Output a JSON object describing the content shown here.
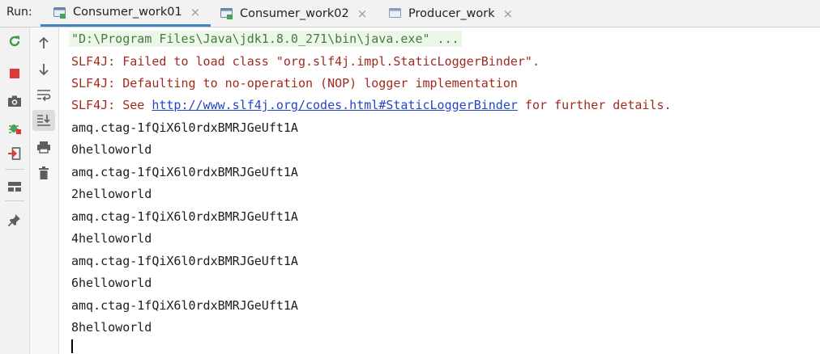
{
  "run_label": "Run:",
  "tabs": [
    {
      "label": "Consumer_work01",
      "active": true
    },
    {
      "label": "Consumer_work02",
      "active": false
    },
    {
      "label": "Producer_work",
      "active": false
    }
  ],
  "tab_close_glyph": "×",
  "toolbar_left": [
    {
      "icon": "rerun-icon"
    },
    {
      "icon": "stop-icon"
    },
    {
      "icon": "camera-icon"
    },
    {
      "icon": "debug-bug-icon"
    },
    {
      "icon": "exit-icon"
    },
    {
      "icon": "layout-icon"
    },
    {
      "icon": "pin-icon"
    }
  ],
  "toolbar_right": [
    {
      "icon": "arrow-up-icon"
    },
    {
      "icon": "arrow-down-icon"
    },
    {
      "icon": "soft-wrap-icon"
    },
    {
      "icon": "scroll-to-end-icon",
      "pressed": true
    },
    {
      "icon": "print-icon"
    },
    {
      "icon": "trash-icon"
    }
  ],
  "colors": {
    "command": "#467a43",
    "error": "#a12a1f",
    "link": "#2346c9",
    "output": "#1d1d1d",
    "accent": "#4083c9"
  },
  "console": {
    "command": "\"D:\\Program Files\\Java\\jdk1.8.0_271\\bin\\java.exe\" ...",
    "err1": "SLF4J: Failed to load class \"org.slf4j.impl.StaticLoggerBinder\".",
    "err2": "SLF4J: Defaulting to no-operation (NOP) logger implementation",
    "err3_prefix": "SLF4J: See ",
    "err3_link": "http://www.slf4j.org/codes.html#StaticLoggerBinder",
    "err3_suffix": " for further details.",
    "output": [
      "amq.ctag-1fQiX6l0rdxBMRJGeUft1A",
      "0helloworld",
      "amq.ctag-1fQiX6l0rdxBMRJGeUft1A",
      "2helloworld",
      "amq.ctag-1fQiX6l0rdxBMRJGeUft1A",
      "4helloworld",
      "amq.ctag-1fQiX6l0rdxBMRJGeUft1A",
      "6helloworld",
      "amq.ctag-1fQiX6l0rdxBMRJGeUft1A",
      "8helloworld"
    ]
  }
}
